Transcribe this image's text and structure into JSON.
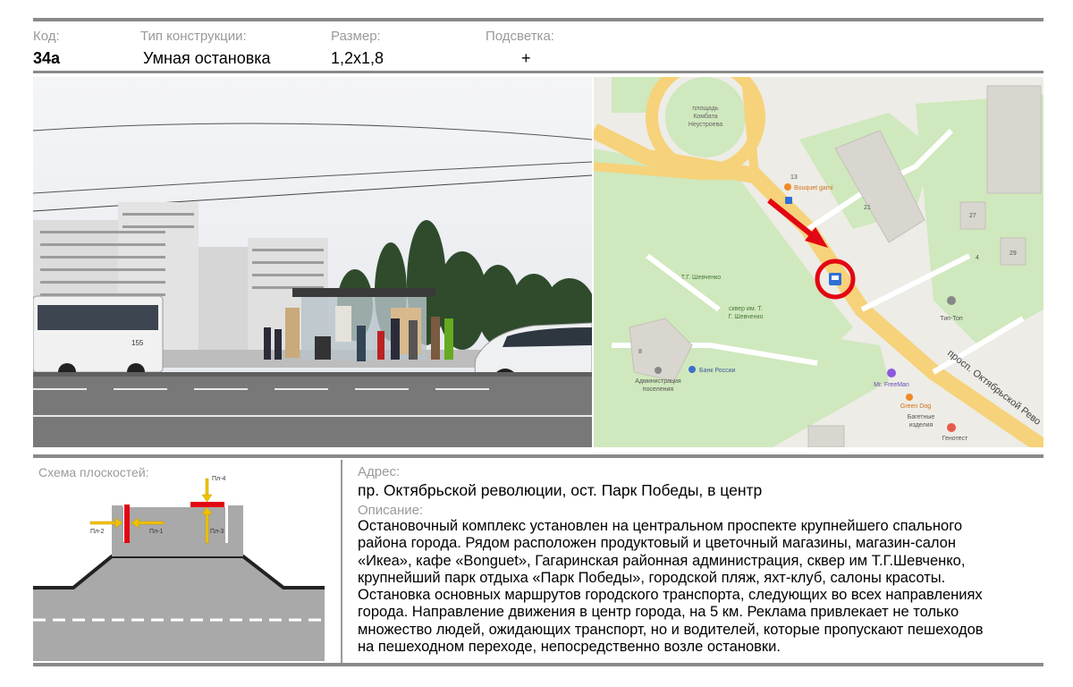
{
  "header": {
    "code_label": "Код:",
    "code_value": "34а",
    "type_label": "Тип конструкции:",
    "type_value": "Умная остановка",
    "size_label": "Размер:",
    "size_value": "1,2х1,8",
    "light_label": "Подсветка:",
    "light_value": "+"
  },
  "map": {
    "square_label": [
      "площадь",
      "Комбата",
      "Неустроева"
    ],
    "bouquet_label": "Bouquet garni",
    "house_13": "13",
    "house_21": "21",
    "house_27": "27",
    "house_29": "29",
    "house_43": "4",
    "monument_label": "Т.Г. Шевченко",
    "park_label": [
      "сквер им. Т.",
      "Г. Шевченко"
    ],
    "tiptop_label": "Тип-Топ",
    "house_8": "8",
    "admin_label": [
      "Администрация",
      "поселения"
    ],
    "bank_label": "Банк России",
    "freeman_label": "Mr. FreeMan",
    "greendog_label": "Green Dog",
    "bagel_label": [
      "Багетные",
      "изделия"
    ],
    "genotest_label": "Генотест",
    "avenue_label": "просп. Октябрьской Рево"
  },
  "scheme": {
    "title": "Схема плоскостей:",
    "p1": "Пл-1",
    "p2": "Пл-2",
    "p3": "Пл-3",
    "p4": "Пл-4"
  },
  "address": {
    "label": "Адрес:",
    "value": "пр. Октябрьской революции, ост. Парк Победы, в центр"
  },
  "description": {
    "label": "Описание:",
    "lines": [
      "Остановочный комплекс установлен на центральном проспекте крупнейшего спального",
      "района города. Рядом  расположен продуктовый и цветочный магазины, магазин-салон",
      "«Икеа», кафе «Bonguet», Гагаринская районная администрация, сквер им Т.Г.Шевченко,",
      "крупнейший парк отдыха «Парк Победы», городской пляж, яхт-клуб, салоны красоты.",
      "Остановка основных маршрутов городского транспорта, следующих во всех направлениях",
      "города. Направление движения в центр города, на 5 км. Реклама привлекает не только",
      "множество людей, ожидающих транспорт, но и водителей, которые пропускают пешеходов",
      "на  пешеходном переходе,  непосредственно возле остановки."
    ]
  },
  "photo": {
    "bus_number": "155"
  },
  "colors": {
    "accent_red": "#e30613",
    "arrow_yellow": "#f2c200",
    "road_gray": "#a9a9a9",
    "map_green": "#c8e6b4",
    "map_road": "#f6d27a"
  }
}
